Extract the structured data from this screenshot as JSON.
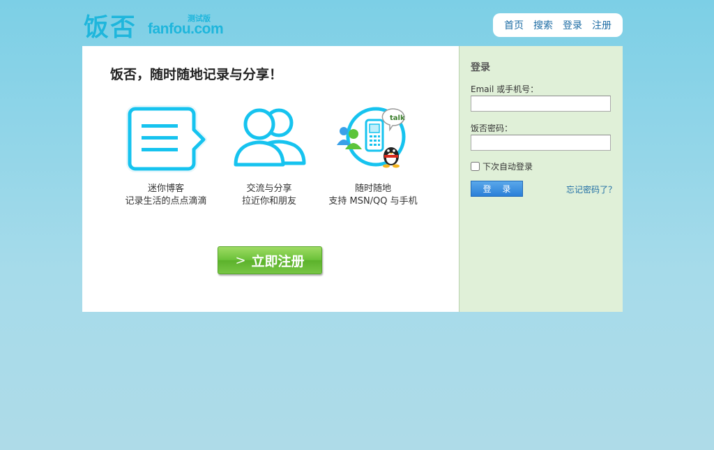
{
  "header": {
    "logo_cn": "饭否",
    "logo_en": "fanfou.com",
    "logo_beta": "测试版",
    "nav": [
      {
        "label": "首页"
      },
      {
        "label": "搜索"
      },
      {
        "label": "登录"
      },
      {
        "label": "注册"
      }
    ]
  },
  "main": {
    "headline": "饭否，随时随地记录与分享！",
    "features": [
      {
        "icon": "speech-bubble-icon",
        "line1": "迷你博客",
        "line2": "记录生活的点点滴滴"
      },
      {
        "icon": "people-icon",
        "line1": "交流与分享",
        "line2": "拉近你和朋友"
      },
      {
        "icon": "im-phone-icon",
        "line1": "随时随地",
        "line2": "支持 MSN/QQ 与手机",
        "badge": "talk"
      }
    ],
    "signup_button": {
      "chevron": ">",
      "label": "立即注册"
    }
  },
  "login": {
    "title": "登录",
    "email_label": "Email 或手机号：",
    "email_value": "",
    "password_label": "饭否密码：",
    "password_value": "",
    "remember_label": "下次自动登录",
    "remember_checked": false,
    "login_button": "登 录",
    "forgot_link": "忘记密码了？"
  },
  "colors": {
    "accent": "#1fb6dc",
    "link": "#1d6ca4",
    "sidebar_bg": "#e0f0d8",
    "signup_green": "#6cc23a",
    "login_blue": "#2a7fd8"
  }
}
